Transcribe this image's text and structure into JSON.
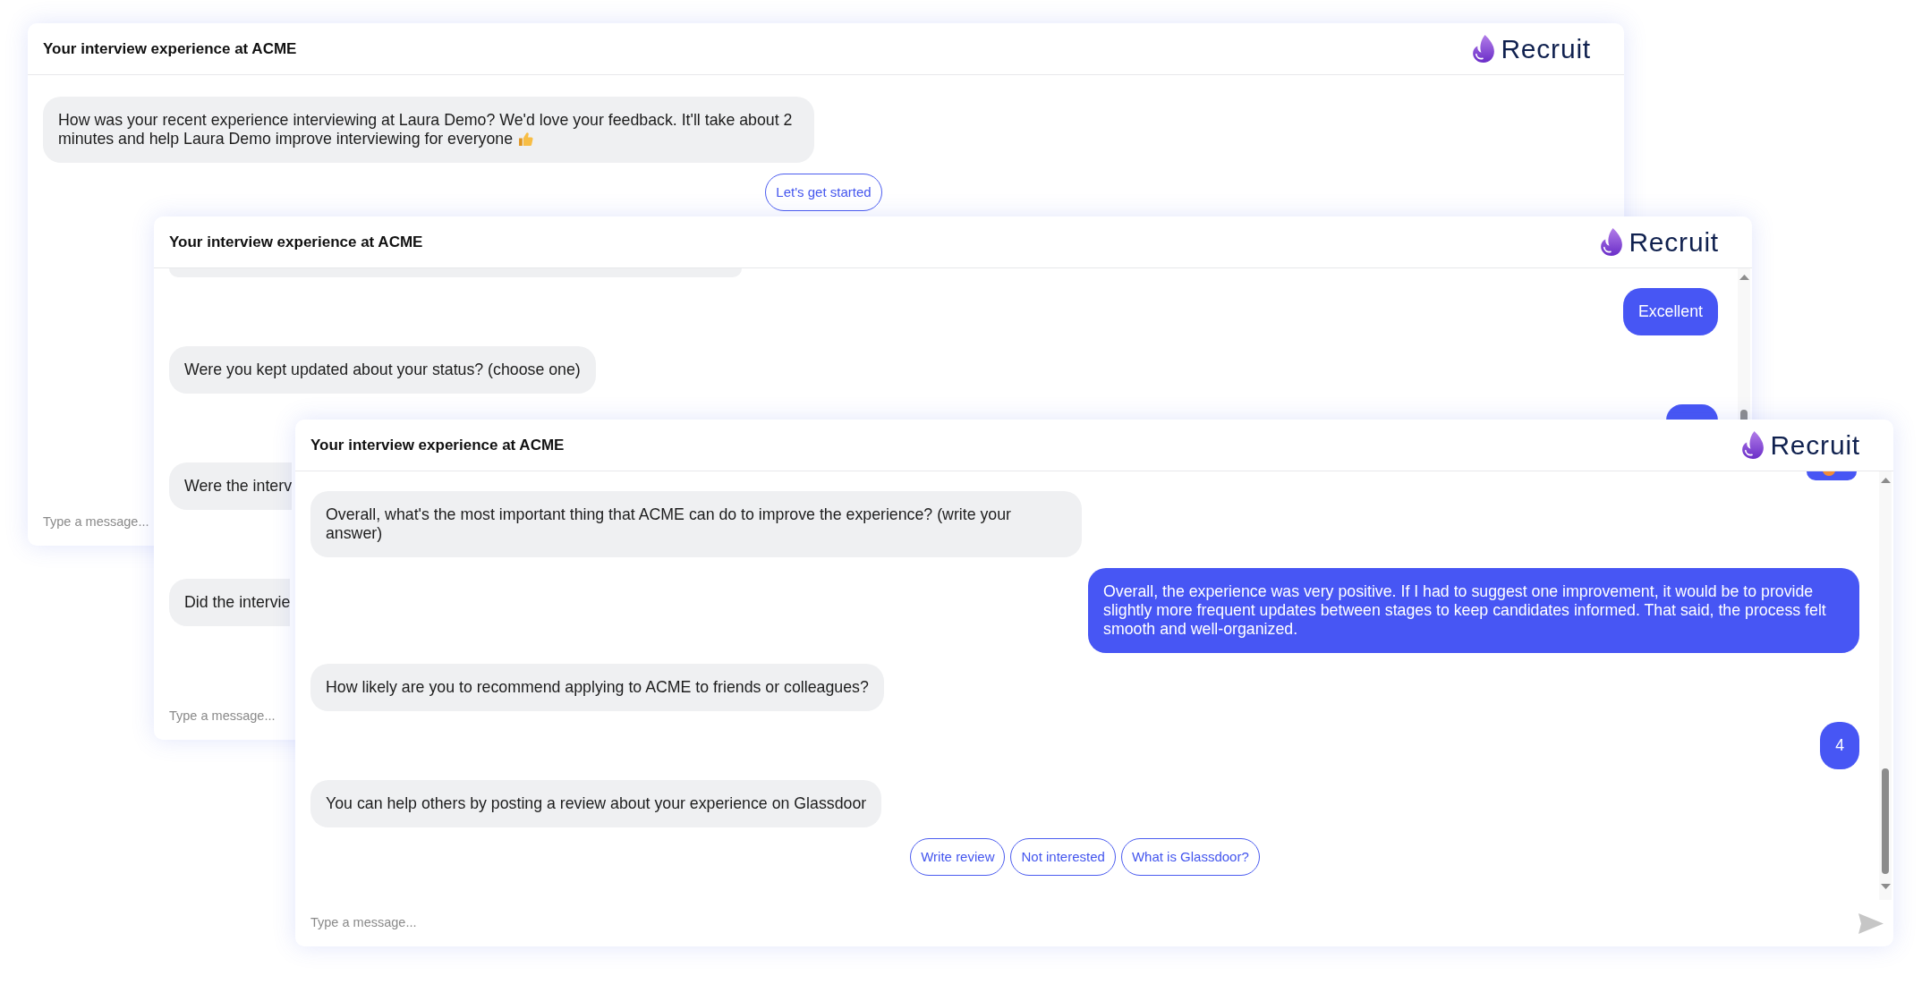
{
  "windows": [
    {
      "title": "Your interview experience at ACME",
      "logo": "Recruit",
      "messages": [
        {
          "outgoing": false,
          "kind": "message",
          "text": "How was your recent experience interviewing at Laura Demo? We'd love your feedback. It'll take about 2 minutes and help Laura Demo improve interviewing for everyone",
          "emoji": true
        }
      ],
      "quick_replies": [
        "Let's get started"
      ],
      "input": {
        "placeholder": "Type a message..."
      }
    },
    {
      "title": "Your interview experience at ACME",
      "logo": "Recruit",
      "messages": [
        {
          "outgoing": false,
          "kind": "tail"
        },
        {
          "outgoing": true,
          "kind": "message",
          "text": "Excellent"
        },
        {
          "outgoing": false,
          "kind": "message",
          "text": "Were you kept updated about your status? (choose one)"
        },
        {
          "outgoing": true,
          "kind": "head"
        },
        {
          "outgoing": false,
          "kind": "covered",
          "text": "Were the interv"
        },
        {
          "outgoing": false,
          "kind": "covered",
          "text": "Did the intervie"
        }
      ],
      "input": {
        "placeholder": "Type a message..."
      }
    },
    {
      "title": "Your interview experience at ACME",
      "logo": "Recruit",
      "messages": [
        {
          "outgoing": true,
          "kind": "tail",
          "emoji": true
        },
        {
          "outgoing": false,
          "kind": "message",
          "text": "Overall, what's the most important thing that ACME can do to improve the experience? (write your answer)"
        },
        {
          "outgoing": true,
          "kind": "message",
          "text": "Overall, the experience was very positive. If I had to suggest one improvement, it would be to provide slightly more frequent updates between stages to keep candidates informed. That said, the process felt smooth and well-organized."
        },
        {
          "outgoing": false,
          "kind": "message",
          "text": "How likely are you to recommend applying to ACME to friends or colleagues?"
        },
        {
          "outgoing": true,
          "kind": "message",
          "text": "4"
        },
        {
          "outgoing": false,
          "kind": "message",
          "text": "You can help others by posting a review about your experience on Glassdoor"
        }
      ],
      "quick_replies": [
        "Write review",
        "Not interested",
        "What is Glassdoor?"
      ],
      "input": {
        "placeholder": "Type a message..."
      }
    }
  ]
}
